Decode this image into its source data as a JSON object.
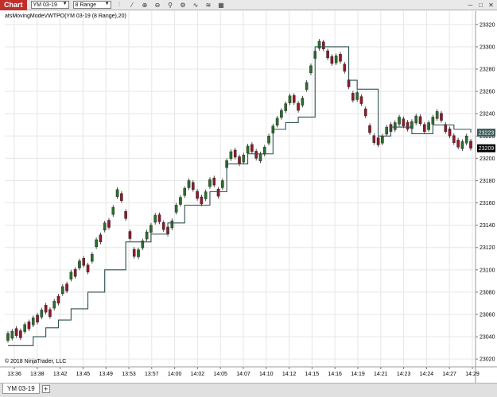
{
  "toolbar": {
    "chart_tab": "Chart",
    "instrument": "YM 03-19",
    "bar_type": "8 Range",
    "icons": [
      "bar-style-icon",
      "draw-line-icon",
      "zoom-in-icon",
      "zoom-out-icon",
      "properties-icon",
      "strategies-icon",
      "indicators-icon",
      "templates-icon",
      "data-box-icon"
    ]
  },
  "chart": {
    "indicator_label": "atsMovingModeVWTPO(YM 03-19 (8 Range),20)",
    "copyright": "© 2018 NinjaTrader, LLC",
    "price_badges": [
      "23223",
      "23209"
    ],
    "badge_colors": [
      "#3b5a5a",
      "#000000"
    ]
  },
  "chart_data": {
    "type": "candlestick",
    "y_ticks": [
      23320,
      23300,
      23280,
      23260,
      23240,
      23220,
      23200,
      23180,
      23160,
      23140,
      23120,
      23100,
      23080,
      23060,
      23040,
      23020
    ],
    "x_ticks": [
      "13:36",
      "13:38",
      "13:42",
      "13:45",
      "13:49",
      "13:53",
      "13:57",
      "14:00",
      "14:02",
      "14:05",
      "14:07",
      "14:10",
      "14:12",
      "14:15",
      "14:16",
      "14:19",
      "14:21",
      "14:23",
      "14:24",
      "14:27",
      "14:29"
    ],
    "ylim": [
      23013,
      23332
    ],
    "grid": true,
    "colors": {
      "up": "#2b6e2b",
      "down": "#8e1a2c",
      "indicator": "#2f4f4f"
    },
    "closes": [
      23043,
      23045,
      23041,
      23039,
      23051,
      23047,
      23057,
      23053,
      23064,
      23062,
      23058,
      23072,
      23070,
      23085,
      23081,
      23098,
      23094,
      23108,
      23104,
      23098,
      23114,
      23127,
      23125,
      23142,
      23138,
      23156,
      23172,
      23162,
      23146,
      23128,
      23112,
      23118,
      23126,
      23134,
      23140,
      23149,
      23143,
      23136,
      23132,
      23144,
      23158,
      23165,
      23173,
      23180,
      23172,
      23164,
      23159,
      23170,
      23181,
      23176,
      23166,
      23180,
      23198,
      23206,
      23201,
      23195,
      23203,
      23211,
      23206,
      23200,
      23204,
      23210,
      23220,
      23229,
      23236,
      23243,
      23249,
      23256,
      23250,
      23243,
      23254,
      23268,
      23283,
      23296,
      23305,
      23298,
      23290,
      23285,
      23292,
      23287,
      23278,
      23264,
      23252,
      23259,
      23249,
      23238,
      23223,
      23214,
      23212,
      23220,
      23228,
      23224,
      23232,
      23237,
      23229,
      23226,
      23233,
      23238,
      23231,
      23224,
      23232,
      23237,
      23242,
      23234,
      23224,
      23220,
      23214,
      23210,
      23215,
      23220,
      23209
    ],
    "indicator": [
      23032,
      23032,
      23032,
      23032,
      23032,
      23032,
      23040,
      23040,
      23040,
      23048,
      23048,
      23048,
      23055,
      23055,
      23055,
      23065,
      23065,
      23065,
      23065,
      23080,
      23080,
      23080,
      23080,
      23100,
      23100,
      23100,
      23100,
      23100,
      23125,
      23125,
      23125,
      23125,
      23125,
      23125,
      23132,
      23132,
      23132,
      23132,
      23142,
      23142,
      23142,
      23142,
      23158,
      23158,
      23158,
      23158,
      23158,
      23158,
      23170,
      23170,
      23170,
      23170,
      23195,
      23195,
      23195,
      23195,
      23195,
      23204,
      23204,
      23204,
      23204,
      23204,
      23204,
      23226,
      23226,
      23226,
      23232,
      23232,
      23232,
      23237,
      23237,
      23237,
      23237,
      23300,
      23300,
      23300,
      23300,
      23300,
      23300,
      23300,
      23300,
      23270,
      23270,
      23262,
      23262,
      23262,
      23262,
      23262,
      23220,
      23220,
      23220,
      23228,
      23228,
      23228,
      23228,
      23228,
      23222,
      23222,
      23222,
      23222,
      23222,
      23230,
      23230,
      23230,
      23230,
      23230,
      23226,
      23226,
      23226,
      23226,
      23223
    ]
  },
  "bottom": {
    "tab_label": "YM 03-19",
    "add_label": "+"
  }
}
